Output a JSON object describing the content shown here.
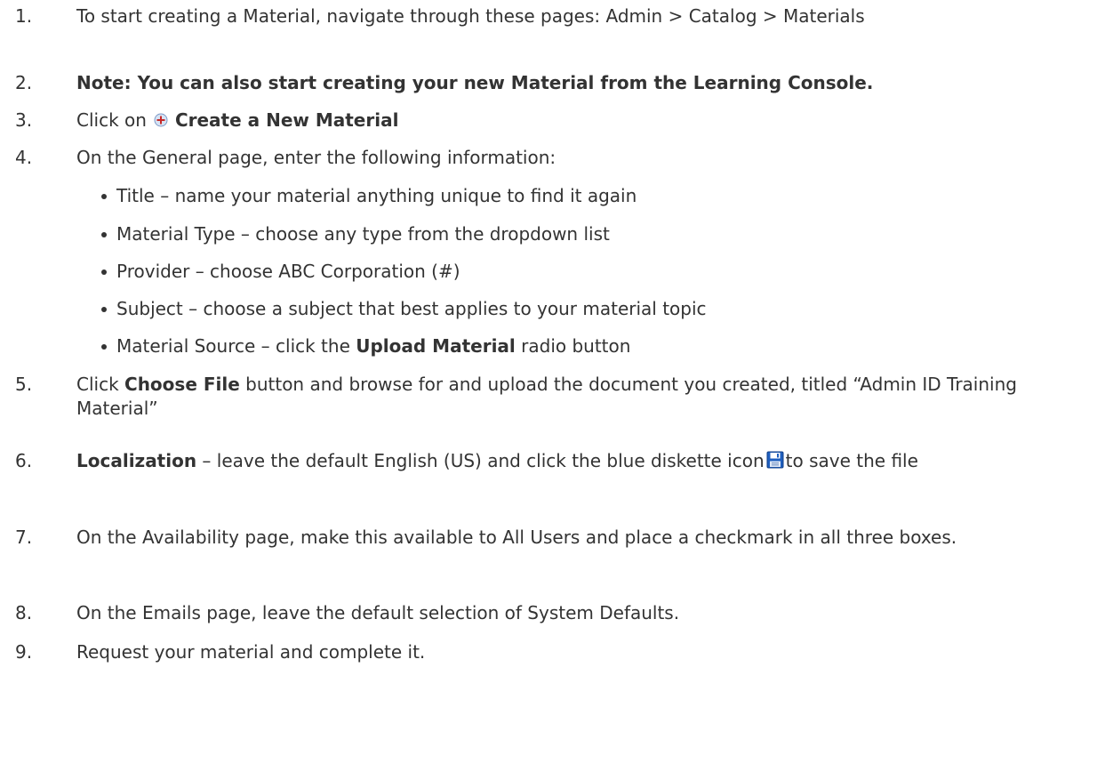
{
  "steps": [
    {
      "num": "1.",
      "text": "To start creating a Material, navigate through these pages: Admin > Catalog > Materials"
    },
    {
      "num": "2.",
      "text": "Note:  You can also start creating your new Material from the Learning Console."
    },
    {
      "num": "3.",
      "before": "Click on",
      "bold": "Create a New Material"
    },
    {
      "num": "4.",
      "text": "On the General page, enter the following information:"
    },
    {
      "num": "5.",
      "before": "Click ",
      "bold": "Choose File",
      "after": " button and browse for and upload the document you created, titled “Admin ID Training Material”"
    },
    {
      "num": "6.",
      "bold": "Localization",
      "before": " – leave the default English (US) and click the blue diskette icon",
      "after": "to save the file"
    },
    {
      "num": "7.",
      "text": "On the Availability page, make this available to All Users and place a checkmark in all three boxes."
    },
    {
      "num": "8.",
      "text": "On the Emails page, leave the default selection of System Defaults."
    },
    {
      "num": "9.",
      "text": "Request your material and complete it."
    }
  ],
  "bullets": [
    {
      "text": "Title – name your material anything unique to find it again"
    },
    {
      "text": "Material Type – choose any type from the dropdown list"
    },
    {
      "text": "Provider – choose ABC Corporation (#)"
    },
    {
      "text": "Subject – choose a subject that best applies to your material topic"
    },
    {
      "before": "Material Source – click the ",
      "bold": "Upload Material",
      "after": " radio button"
    }
  ],
  "icons": {
    "plus": "plus-icon",
    "diskette": "diskette-icon"
  }
}
